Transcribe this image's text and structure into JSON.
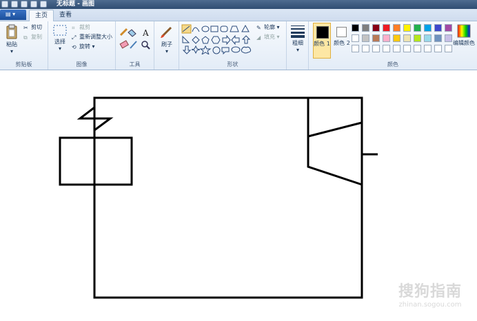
{
  "window": {
    "title": "无标题 - 画图"
  },
  "tabs": [
    {
      "label": "主页"
    },
    {
      "label": "查看"
    }
  ],
  "clipboard": {
    "paste": "粘贴",
    "cut": "剪切",
    "copy": "复制",
    "label": "剪贴板"
  },
  "image": {
    "select": "选择",
    "crop": "裁剪",
    "resize": "重新调整大小",
    "rotate": "旋转",
    "label": "图像"
  },
  "tools": {
    "label": "工具"
  },
  "brushes": {
    "label": "刷子"
  },
  "shapes": {
    "outline": "轮廓",
    "fill": "填充",
    "label": "形状"
  },
  "size": {
    "label": "粗细"
  },
  "colors": {
    "color1": "颜色 1",
    "color2": "颜色 2",
    "edit": "编辑颜色",
    "label": "颜色",
    "color1_value": "#000000",
    "color2_value": "#ffffff",
    "palette_row1": [
      "#000000",
      "#7f7f7f",
      "#880015",
      "#ed1c24",
      "#ff7f27",
      "#fff200",
      "#22b14c",
      "#00a2e8",
      "#3f48cc",
      "#a349a4"
    ],
    "palette_row2": [
      "#ffffff",
      "#c3c3c3",
      "#b97a57",
      "#ffaec9",
      "#ffc90e",
      "#efe4b0",
      "#b5e61d",
      "#99d9ea",
      "#7092be",
      "#c8bfe7"
    ]
  },
  "watermark": {
    "main": "搜狗指南",
    "url": "zhinan.sogou.com"
  }
}
